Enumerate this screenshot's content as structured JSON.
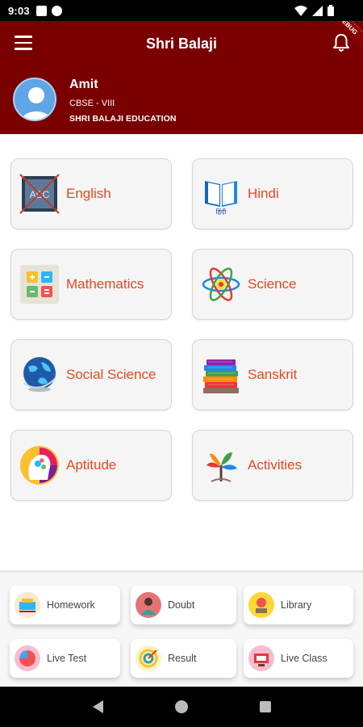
{
  "status_bar": {
    "time": "9:03",
    "icons": [
      "notification-a-icon",
      "notification-f-icon",
      "wifi-icon",
      "signal-icon",
      "battery-icon"
    ]
  },
  "app_bar": {
    "title": "Shri Balaji",
    "debug_ribbon": "DEBUG"
  },
  "profile": {
    "name": "Amit",
    "class": "CBSE - VIII",
    "school": "SHRI BALAJI EDUCATION"
  },
  "subjects": [
    {
      "label": "English",
      "icon": "english-abc-icon"
    },
    {
      "label": "Hindi",
      "icon": "hindi-book-icon"
    },
    {
      "label": "Mathematics",
      "icon": "math-calculator-icon"
    },
    {
      "label": "Science",
      "icon": "atom-icon"
    },
    {
      "label": "Social Science",
      "icon": "globe-icon"
    },
    {
      "label": "Sanskrit",
      "icon": "books-stack-icon"
    },
    {
      "label": "Aptitude",
      "icon": "brain-gears-icon"
    },
    {
      "label": "Activities",
      "icon": "activities-tree-icon"
    }
  ],
  "quick_actions": [
    {
      "label": "Homework",
      "icon": "homework-icon"
    },
    {
      "label": "Doubt",
      "icon": "doubt-icon"
    },
    {
      "label": "Library",
      "icon": "library-icon"
    },
    {
      "label": "Live Test",
      "icon": "live-test-icon"
    },
    {
      "label": "Result",
      "icon": "result-icon"
    },
    {
      "label": "Live Class",
      "icon": "live-class-icon"
    }
  ],
  "colors": {
    "brand": "#7a0000",
    "subject_text": "#e8461f"
  }
}
